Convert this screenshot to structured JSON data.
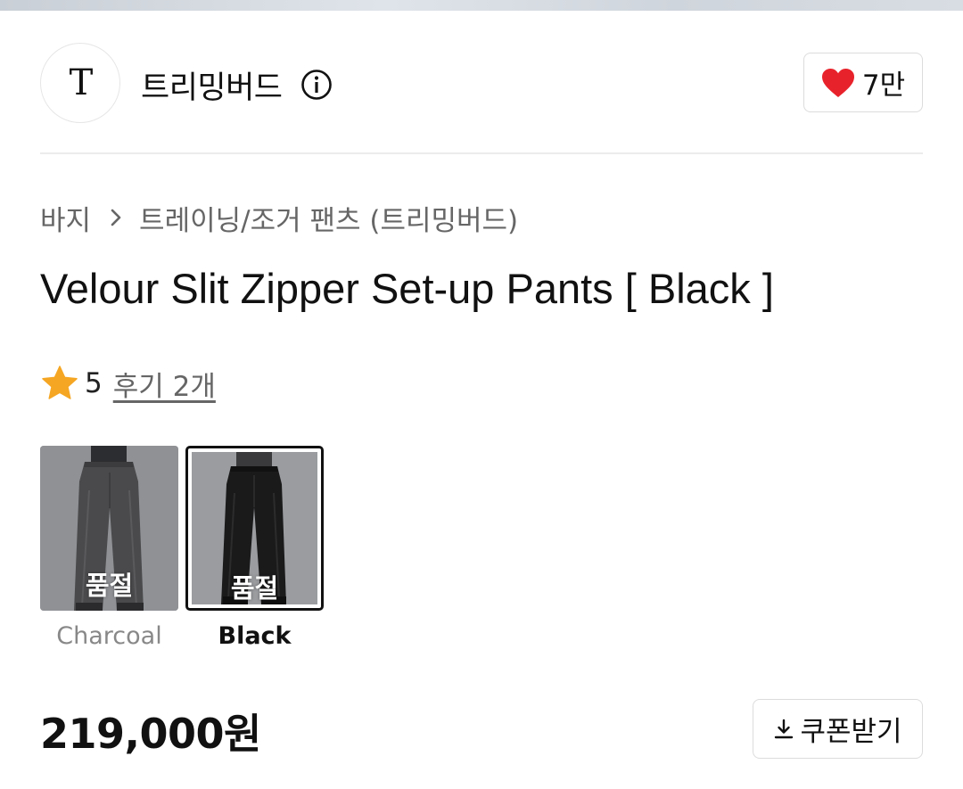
{
  "brand": {
    "logo_text": "T",
    "name": "트리밍버드",
    "info_icon": "info-icon"
  },
  "like": {
    "icon": "heart-icon",
    "count": "7만",
    "color": "#e8222b"
  },
  "breadcrumb": {
    "items": [
      "바지",
      "트레이닝/조거 팬츠 (트리밍버드)"
    ],
    "separator_icon": "chevron-right-icon"
  },
  "product": {
    "title": "Velour Slit Zipper Set-up Pants [ Black ]"
  },
  "rating": {
    "icon": "star-icon",
    "star_color": "#f5a623",
    "score": "5",
    "review_label": "후기 2개"
  },
  "options": [
    {
      "label": "Charcoal",
      "badge": "품절",
      "selected": false
    },
    {
      "label": "Black",
      "badge": "품절",
      "selected": true
    }
  ],
  "price": {
    "value": "219,000원"
  },
  "coupon": {
    "icon": "download-icon",
    "label": "쿠폰받기"
  }
}
